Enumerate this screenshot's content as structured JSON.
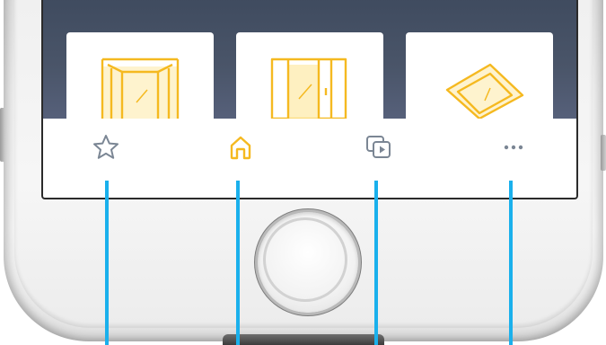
{
  "colors": {
    "accent": "#f5b920",
    "tab_inactive": "#7b8694",
    "screen_bg": "#4a5569",
    "callout": "#1ab0ec",
    "card_bg": "#ffffff"
  },
  "cards": [
    {
      "icon": "door-frame-icon"
    },
    {
      "icon": "sliding-door-icon"
    },
    {
      "icon": "tilted-window-icon"
    }
  ],
  "tabbar": {
    "tabs": [
      {
        "icon": "star-icon",
        "active": false
      },
      {
        "icon": "home-icon",
        "active": true
      },
      {
        "icon": "media-library-icon",
        "active": false
      },
      {
        "icon": "more-icon",
        "active": false
      }
    ]
  }
}
